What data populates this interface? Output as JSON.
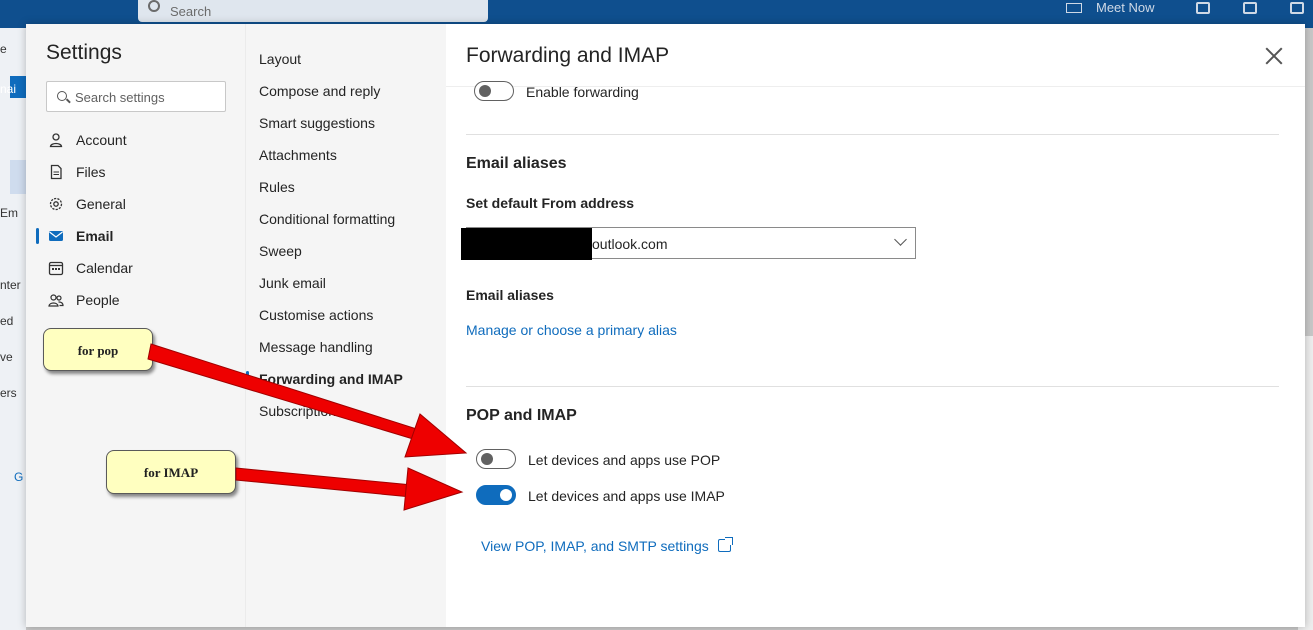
{
  "background": {
    "search_placeholder": "Search",
    "meet_now": "Meet Now",
    "left_fragments": [
      "e",
      "nai",
      "Em",
      "nter",
      "ed",
      "ve",
      "ers",
      "G"
    ]
  },
  "settings": {
    "title": "Settings",
    "search_placeholder": "Search settings",
    "categories": [
      {
        "label": "Account",
        "icon": "person-icon"
      },
      {
        "label": "Files",
        "icon": "file-icon"
      },
      {
        "label": "General",
        "icon": "gear-icon"
      },
      {
        "label": "Email",
        "icon": "mail-icon"
      },
      {
        "label": "Calendar",
        "icon": "calendar-icon"
      },
      {
        "label": "People",
        "icon": "people-icon"
      }
    ],
    "active_category": "Email",
    "subcategories": [
      "Layout",
      "Compose and reply",
      "Smart suggestions",
      "Attachments",
      "Rules",
      "Conditional formatting",
      "Sweep",
      "Junk email",
      "Customise actions",
      "Message handling",
      "Forwarding and IMAP",
      "Subscriptions"
    ],
    "active_subcategory": "Forwarding and IMAP"
  },
  "panel": {
    "title": "Forwarding and IMAP",
    "enable_forwarding": {
      "label": "Enable forwarding",
      "on": false
    },
    "aliases": {
      "section_title": "Email aliases",
      "default_from_label": "Set default From address",
      "default_from_value": "outlook.com",
      "aliases_label": "Email aliases",
      "manage_link": "Manage or choose a primary alias"
    },
    "pop_imap": {
      "section_title": "POP and IMAP",
      "pop": {
        "label": "Let devices and apps use POP",
        "on": false
      },
      "imap": {
        "label": "Let devices and apps use IMAP",
        "on": true
      },
      "view_settings_link": "View POP, IMAP, and SMTP settings"
    }
  },
  "annotations": {
    "pop_callout": "for pop",
    "imap_callout": "for IMAP",
    "arrow_color": "#ee0000"
  },
  "colors": {
    "accent": "#0f6cbd",
    "topbar": "#0f4f8e"
  }
}
